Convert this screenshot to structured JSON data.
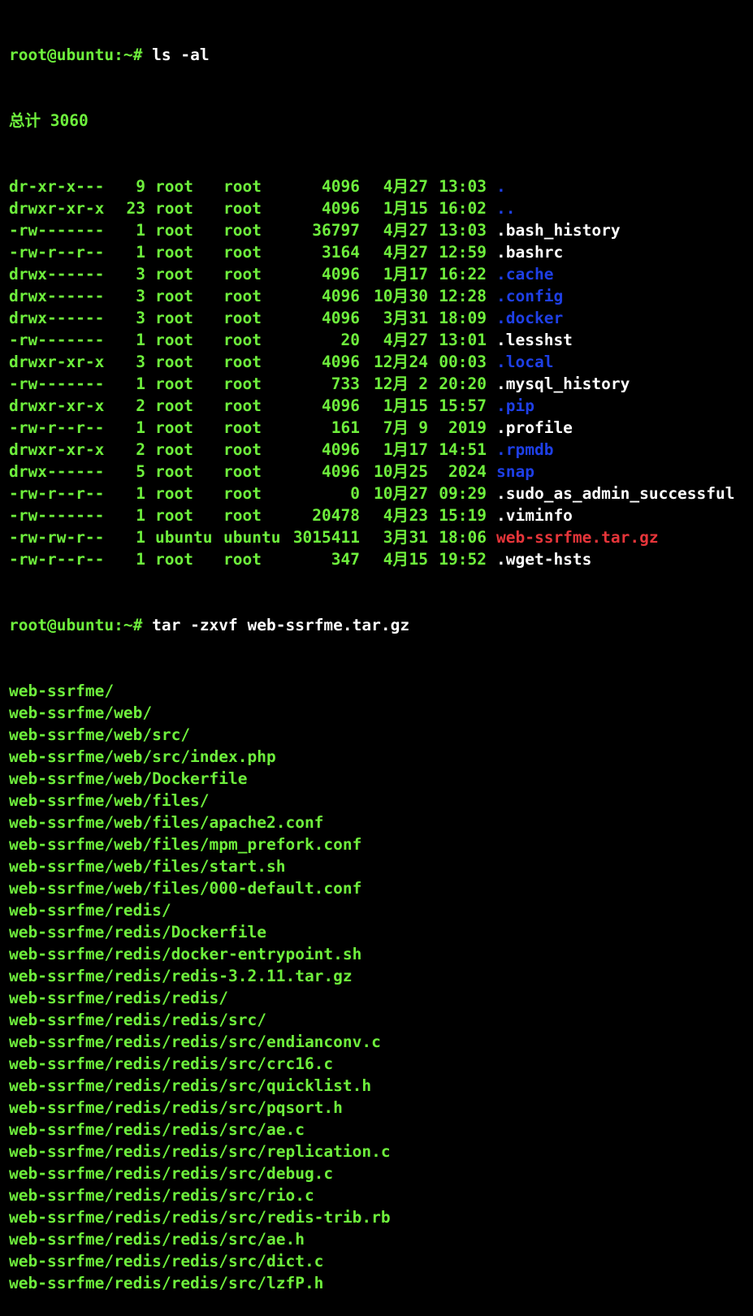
{
  "colors": {
    "background": "#000000",
    "text_green": "#6eef3c",
    "text_white": "#ffffff",
    "dir_blue": "#1e3fe6",
    "archive_red": "#e6353a"
  },
  "terminal": {
    "prompt1": "root@ubuntu:~#",
    "command1": " ls -al",
    "total": "总计 3060",
    "listing": [
      {
        "perm": "dr-xr-x---",
        "links": "9",
        "owner": "root",
        "group": "root",
        "size": "4096",
        "month": "4月",
        "day": "27",
        "time": "13:03",
        "name": ".",
        "kind": "dir"
      },
      {
        "perm": "drwxr-xr-x",
        "links": "23",
        "owner": "root",
        "group": "root",
        "size": "4096",
        "month": "1月",
        "day": "15",
        "time": "16:02",
        "name": "..",
        "kind": "dir"
      },
      {
        "perm": "-rw-------",
        "links": "1",
        "owner": "root",
        "group": "root",
        "size": "36797",
        "month": "4月",
        "day": "27",
        "time": "13:03",
        "name": ".bash_history",
        "kind": "file"
      },
      {
        "perm": "-rw-r--r--",
        "links": "1",
        "owner": "root",
        "group": "root",
        "size": "3164",
        "month": "4月",
        "day": "27",
        "time": "12:59",
        "name": ".bashrc",
        "kind": "file"
      },
      {
        "perm": "drwx------",
        "links": "3",
        "owner": "root",
        "group": "root",
        "size": "4096",
        "month": "1月",
        "day": "17",
        "time": "16:22",
        "name": ".cache",
        "kind": "dir"
      },
      {
        "perm": "drwx------",
        "links": "3",
        "owner": "root",
        "group": "root",
        "size": "4096",
        "month": "10月",
        "day": "30",
        "time": "12:28",
        "name": ".config",
        "kind": "dir"
      },
      {
        "perm": "drwx------",
        "links": "3",
        "owner": "root",
        "group": "root",
        "size": "4096",
        "month": "3月",
        "day": "31",
        "time": "18:09",
        "name": ".docker",
        "kind": "dir"
      },
      {
        "perm": "-rw-------",
        "links": "1",
        "owner": "root",
        "group": "root",
        "size": "20",
        "month": "4月",
        "day": "27",
        "time": "13:01",
        "name": ".lesshst",
        "kind": "file"
      },
      {
        "perm": "drwxr-xr-x",
        "links": "3",
        "owner": "root",
        "group": "root",
        "size": "4096",
        "month": "12月",
        "day": "24",
        "time": "00:03",
        "name": ".local",
        "kind": "dir"
      },
      {
        "perm": "-rw-------",
        "links": "1",
        "owner": "root",
        "group": "root",
        "size": "733",
        "month": "12月",
        "day": "2",
        "time": "20:20",
        "name": ".mysql_history",
        "kind": "file"
      },
      {
        "perm": "drwxr-xr-x",
        "links": "2",
        "owner": "root",
        "group": "root",
        "size": "4096",
        "month": "1月",
        "day": "15",
        "time": "15:57",
        "name": ".pip",
        "kind": "dir"
      },
      {
        "perm": "-rw-r--r--",
        "links": "1",
        "owner": "root",
        "group": "root",
        "size": "161",
        "month": "7月",
        "day": "9",
        "time": "2019",
        "name": ".profile",
        "kind": "file"
      },
      {
        "perm": "drwxr-xr-x",
        "links": "2",
        "owner": "root",
        "group": "root",
        "size": "4096",
        "month": "1月",
        "day": "17",
        "time": "14:51",
        "name": ".rpmdb",
        "kind": "dir"
      },
      {
        "perm": "drwx------",
        "links": "5",
        "owner": "root",
        "group": "root",
        "size": "4096",
        "month": "10月",
        "day": "25",
        "time": "2024",
        "name": "snap",
        "kind": "dir"
      },
      {
        "perm": "-rw-r--r--",
        "links": "1",
        "owner": "root",
        "group": "root",
        "size": "0",
        "month": "10月",
        "day": "27",
        "time": "09:29",
        "name": ".sudo_as_admin_successful",
        "kind": "file"
      },
      {
        "perm": "-rw-------",
        "links": "1",
        "owner": "root",
        "group": "root",
        "size": "20478",
        "month": "4月",
        "day": "23",
        "time": "15:19",
        "name": ".viminfo",
        "kind": "file"
      },
      {
        "perm": "-rw-rw-r--",
        "links": "1",
        "owner": "ubuntu",
        "group": "ubuntu",
        "size": "3015411",
        "month": "3月",
        "day": "31",
        "time": "18:06",
        "name": "web-ssrfme.tar.gz",
        "kind": "archive"
      },
      {
        "perm": "-rw-r--r--",
        "links": "1",
        "owner": "root",
        "group": "root",
        "size": "347",
        "month": "4月",
        "day": "15",
        "time": "19:52",
        "name": ".wget-hsts",
        "kind": "file"
      }
    ],
    "prompt2": "root@ubuntu:~#",
    "command2": " tar -zxvf web-ssrfme.tar.gz",
    "extracted": [
      "web-ssrfme/",
      "web-ssrfme/web/",
      "web-ssrfme/web/src/",
      "web-ssrfme/web/src/index.php",
      "web-ssrfme/web/Dockerfile",
      "web-ssrfme/web/files/",
      "web-ssrfme/web/files/apache2.conf",
      "web-ssrfme/web/files/mpm_prefork.conf",
      "web-ssrfme/web/files/start.sh",
      "web-ssrfme/web/files/000-default.conf",
      "web-ssrfme/redis/",
      "web-ssrfme/redis/Dockerfile",
      "web-ssrfme/redis/docker-entrypoint.sh",
      "web-ssrfme/redis/redis-3.2.11.tar.gz",
      "web-ssrfme/redis/redis/",
      "web-ssrfme/redis/redis/src/",
      "web-ssrfme/redis/redis/src/endianconv.c",
      "web-ssrfme/redis/redis/src/crc16.c",
      "web-ssrfme/redis/redis/src/quicklist.h",
      "web-ssrfme/redis/redis/src/pqsort.h",
      "web-ssrfme/redis/redis/src/ae.c",
      "web-ssrfme/redis/redis/src/replication.c",
      "web-ssrfme/redis/redis/src/debug.c",
      "web-ssrfme/redis/redis/src/rio.c",
      "web-ssrfme/redis/redis/src/redis-trib.rb",
      "web-ssrfme/redis/redis/src/ae.h",
      "web-ssrfme/redis/redis/src/dict.c",
      "web-ssrfme/redis/redis/src/lzfP.h"
    ]
  }
}
